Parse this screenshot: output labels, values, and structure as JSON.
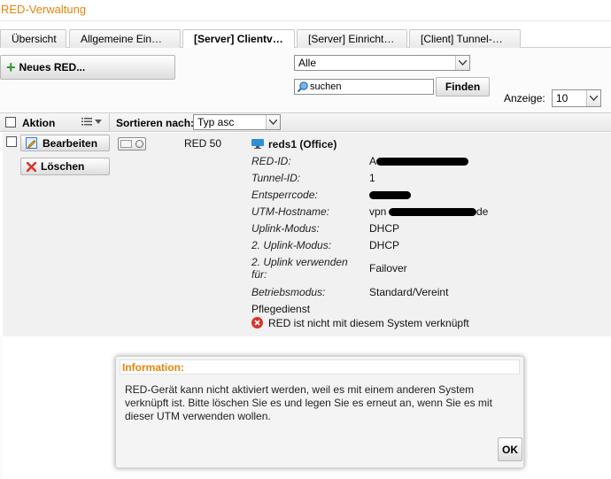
{
  "app": {
    "title": "RED-Verwaltung"
  },
  "tabs": [
    {
      "label": "Übersicht"
    },
    {
      "label": "Allgemeine Ein…"
    },
    {
      "label": "[Server] Clientv…"
    },
    {
      "label": "[Server] Einricht…"
    },
    {
      "label": "[Client] Tunnel-…"
    }
  ],
  "toolbar": {
    "new_button": "Neues RED...",
    "filter_select": "Alle",
    "search_placeholder": "suchen",
    "find_button": "Finden",
    "display_label": "Anzeige:",
    "display_count": "10"
  },
  "table": {
    "action_header": "Aktion",
    "sort_label": "Sortieren nach:",
    "sort_value": "Typ asc"
  },
  "row": {
    "edit_button": "Bearbeiten",
    "delete_button": "Löschen",
    "model": "RED 50",
    "device_name": "reds1 (Office)",
    "fields": [
      {
        "label": "RED-ID:",
        "value": "A"
      },
      {
        "label": "Tunnel-ID:",
        "value": "1"
      },
      {
        "label": "Entsperrcode:",
        "value": ""
      },
      {
        "label": "UTM-Hostname:",
        "value": "vpn"
      },
      {
        "label": "Uplink-Modus:",
        "value": "DHCP"
      },
      {
        "label": "2. Uplink-Modus:",
        "value": "DHCP"
      },
      {
        "label": "2. Uplink verwenden für:",
        "value": "Failover"
      },
      {
        "label": "Betriebsmodus:",
        "value": "Standard/Vereint"
      }
    ],
    "hostname_suffix": "de",
    "service_label": "Pflegedienst",
    "error_text": "RED ist nicht mit diesem System verknüpft"
  },
  "dialog": {
    "title": "Information:",
    "message": "RED-Gerät kann nicht aktiviert werden, weil es mit einem anderen System verknüpft ist. Bitte löschen Sie es und legen Sie es erneut an, wenn Sie es mit dieser UTM verwenden wollen.",
    "ok_button": "OK"
  },
  "colors": {
    "accent": "#e8830c",
    "error": "#d9342b",
    "add_icon": "#2e9a2e"
  },
  "icons": [
    "plus-icon",
    "search-icon",
    "list-icon",
    "edit-icon",
    "delete-icon",
    "toggle-icon",
    "device-icon",
    "error-icon"
  ]
}
